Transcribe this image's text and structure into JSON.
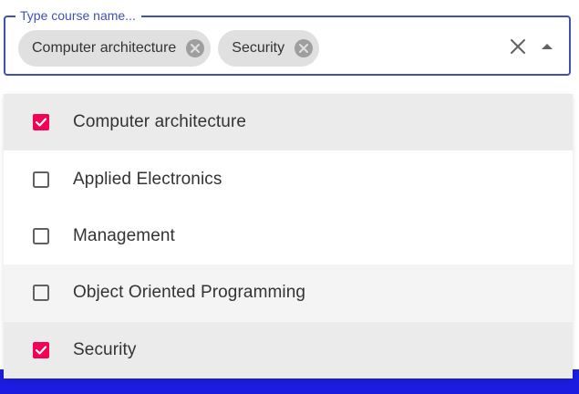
{
  "field": {
    "label": "Type course name..."
  },
  "chips": [
    {
      "label": "Computer architecture"
    },
    {
      "label": "Security"
    }
  ],
  "icons": {
    "chip_remove": "cancel-circle-icon",
    "clear": "close-icon",
    "toggle": "arrow-drop-up-icon",
    "checked": "checkbox-checked-icon",
    "unchecked": "checkbox-unchecked-icon"
  },
  "options": [
    {
      "label": "Computer architecture",
      "checked": true
    },
    {
      "label": "Applied Electronics",
      "checked": false
    },
    {
      "label": "Management",
      "checked": false
    },
    {
      "label": "Object Oriented Programming",
      "checked": false
    },
    {
      "label": "Security",
      "checked": true
    }
  ],
  "colors": {
    "accent": "#3f51b5",
    "checkbox_checked": "#f50057",
    "chip_bg": "#e0e0e0",
    "selected_bg": "#ebebeb"
  }
}
